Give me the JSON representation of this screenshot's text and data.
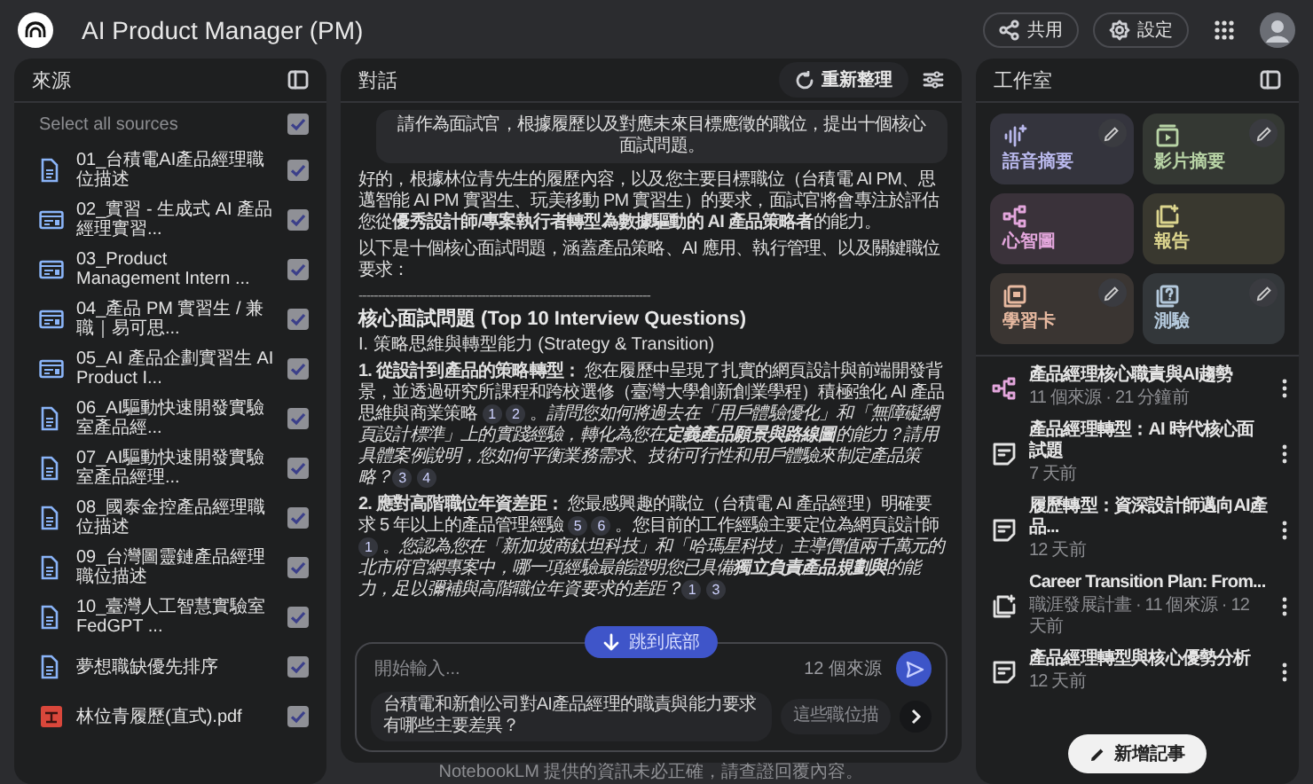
{
  "app": {
    "title": "AI Product Manager (PM)",
    "buttons": [
      {
        "kind": "share",
        "label": "共用"
      },
      {
        "kind": "settings",
        "label": "設定"
      }
    ]
  },
  "sources": {
    "title": "來源",
    "select_all": {
      "label": "Select all sources",
      "checked": true
    },
    "items": [
      {
        "kind": "doc",
        "name": "01_台積電AI產品經理職位描述",
        "checked": true
      },
      {
        "kind": "web",
        "name": "02_實習 - 生成式 AI 產品經理實習...",
        "checked": true
      },
      {
        "kind": "web",
        "name": "03_Product Management Intern ...",
        "checked": true
      },
      {
        "kind": "web",
        "name": "04_產品 PM 實習生 / 兼職｜易可思...",
        "checked": true
      },
      {
        "kind": "web",
        "name": "05_AI 產品企劃實習生 AI Product I...",
        "checked": true
      },
      {
        "kind": "doc",
        "name": "06_AI驅動快速開發實驗室產品經...",
        "checked": true
      },
      {
        "kind": "doc",
        "name": "07_AI驅動快速開發實驗室產品經理...",
        "checked": true
      },
      {
        "kind": "doc",
        "name": "08_國泰金控產品經理職位描述",
        "checked": true
      },
      {
        "kind": "doc",
        "name": "09_台灣圖靈鏈產品經理職位描述",
        "checked": true
      },
      {
        "kind": "doc",
        "name": "10_臺灣人工智慧實驗室 FedGPT ...",
        "checked": true
      },
      {
        "kind": "doc",
        "name": "夢想職缺優先排序",
        "checked": true
      },
      {
        "kind": "pdf",
        "name": "林位青履歷(直式).pdf",
        "checked": true
      }
    ]
  },
  "chat": {
    "title": "對話",
    "refresh_label": "重新整理",
    "user_message": "請作為面試官，根據履歷以及對應未來目標應徵的職位，提出十個核心面試問題。",
    "response": [
      {
        "kind": "paragraph",
        "parts": [
          {
            "kind": "text",
            "text": "好的，根據林位青先生的履歷內容，以及您主要目標職位（台積電 AI PM、思邁智能 AI PM 實習生、玩美移動 PM 實習生）的要求，面試官將會專注於評估您從**優秀設計師/專案執行者轉型為數據驅動的 AI 產品策略者**的能力。"
          }
        ]
      },
      {
        "kind": "paragraph",
        "parts": [
          {
            "kind": "text",
            "text": "以下是十個核心面試問題，涵蓋產品策略、AI 應用、執行管理、以及關鍵職位要求："
          }
        ]
      },
      {
        "kind": "rule",
        "text": "----------------------------------------------------------------------------"
      },
      {
        "kind": "heading",
        "text": "核心面試問題 (Top 10 Interview Questions)"
      },
      {
        "kind": "subheading",
        "text": "I. 策略思維與轉型能力 (Strategy & Transition)"
      },
      {
        "kind": "paragraph",
        "parts": [
          {
            "kind": "text",
            "text": "**1. 從設計到產品的策略轉型：** 您在履歷中呈現了扎實的網頁設計與前端開發背景，並透過研究所課程和跨校選修（臺灣大學創新創業學程）積極強化 AI 產品思維與商業策略 "
          },
          {
            "kind": "citation",
            "text": "1"
          },
          {
            "kind": "citation",
            "text": "2"
          },
          {
            "kind": "text",
            "text": "。"
          },
          {
            "kind": "question",
            "text": "請問您如何將過去在「用戶體驗優化」和「無障礙網頁設計標準」上的實踐經驗，轉化為您在**定義產品願景與路線圖**的能力？請用具體案例說明，您如何平衡業務需求、技術可行性和用戶體驗來制定產品策略？"
          },
          {
            "kind": "citation",
            "text": "3"
          },
          {
            "kind": "citation",
            "text": "4"
          }
        ]
      },
      {
        "kind": "paragraph",
        "parts": [
          {
            "kind": "text",
            "text": "**2. 應對高階職位年資差距：** 您最感興趣的職位（台積電 AI 產品經理）明確要求 5 年以上的產品管理經驗 "
          },
          {
            "kind": "citation",
            "text": "5"
          },
          {
            "kind": "citation",
            "text": "6"
          },
          {
            "kind": "text",
            "text": "。您目前的工作經驗主要定位為網頁設計師 "
          },
          {
            "kind": "citation",
            "text": "1"
          },
          {
            "kind": "text",
            "text": "。"
          },
          {
            "kind": "question",
            "text": "您認為您在「新加坡商鈦坦科技」和「哈瑪星科技」主導價值兩千萬元的北市府官網專案中，哪一項經驗最能證明您已具備**獨立負責產品規劃與**的能力，足以彌補與高階職位年資要求的差距？"
          },
          {
            "kind": "citation",
            "text": "1"
          },
          {
            "kind": "citation",
            "text": "3"
          }
        ]
      }
    ],
    "jump_button": "跳到底部",
    "input": {
      "placeholder": "開始輸入...",
      "source_count": "12 個來源"
    },
    "suggestions": [
      "台積電和新創公司對AI產品經理的職責與能力要求有哪些主要差異？",
      "這些職位描"
    ]
  },
  "disclaimer": "NotebookLM 提供的資訊未必正確，請查證回覆內容。",
  "studio": {
    "title": "工作室",
    "tiles": [
      {
        "kind": "audio",
        "label": "語音摘要",
        "editable": true,
        "color": "#b9b8ec"
      },
      {
        "kind": "video",
        "label": "影片摘要",
        "editable": true,
        "color": "#b8d4a6"
      },
      {
        "kind": "mindmap",
        "label": "心智圖",
        "editable": false,
        "color": "#e3a6dc"
      },
      {
        "kind": "report",
        "label": "報告",
        "editable": false,
        "color": "#dcd58e"
      },
      {
        "kind": "flashcards",
        "label": "學習卡",
        "editable": true,
        "color": "#e7b9a0"
      },
      {
        "kind": "quiz",
        "label": "測驗",
        "editable": true,
        "color": "#b4c9dc"
      }
    ],
    "notes": [
      {
        "kind": "mindmap",
        "title": "產品經理核心職責與AI趨勢",
        "meta": "11 個來源 · 21 分鐘前"
      },
      {
        "kind": "note",
        "title": "產品經理轉型：AI 時代核心面試題",
        "meta": "7 天前"
      },
      {
        "kind": "note",
        "title": "履歷轉型：資深設計師邁向AI產品...",
        "meta": "12 天前"
      },
      {
        "kind": "report",
        "title": "Career Transition Plan: From...",
        "meta": "職涯發展計畫 · 11 個來源 · 12 天前"
      },
      {
        "kind": "note",
        "title": "產品經理轉型與核心優勢分析",
        "meta": "12 天前"
      }
    ],
    "add_note": "新增記事"
  }
}
